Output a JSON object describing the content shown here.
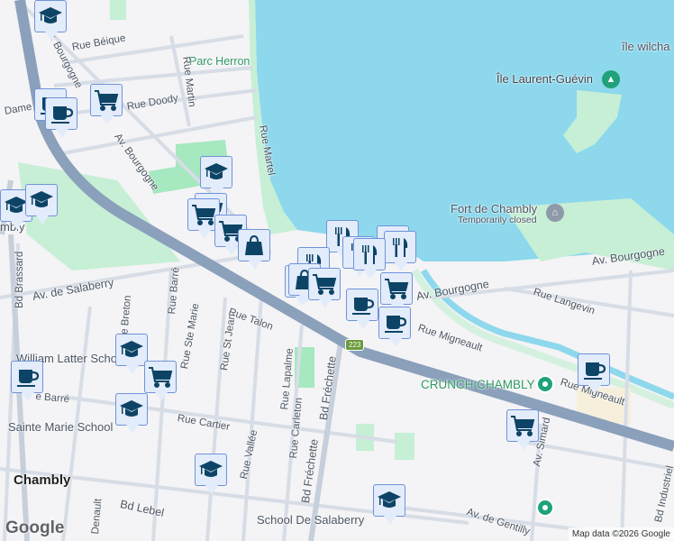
{
  "map": {
    "labels": {
      "parc_herron": "Parc Herron",
      "ile_wilchard": "île wilcha",
      "ile_laurent": "Île Laurent-Guévin",
      "fort_chambly": "Fort de Chambly",
      "fort_status": "Temporarily closed",
      "rue_beique": "Rue Béique",
      "rue_martin": "Rue Martin",
      "rue_martel": "Rue Martel",
      "rue_doody": "Rue Doody",
      "rue_dame": "Dame",
      "av_bourgogne_1": "Av. Bourgogne",
      "av_bourgogne_2": "Av. Bourgogne",
      "av_bourgogne_3": "Av. Bourgogne",
      "av_bourgogne_4": "Av. Bourgogne",
      "bd_brassard": "Bd Brassard",
      "av_salaberry": "Av. de Salaberry",
      "rue_barre": "Rue Barré",
      "rue_breton": "Rue Breton",
      "rue_ste_marie": "Rue Ste Marie",
      "rue_talon": "Rue Talon",
      "rue_st_jean": "Rue St Jean",
      "rue_lapalme": "Rue Lapalme",
      "rue_carleton": "Rue Carleton",
      "bd_frechette": "Bd Fréchette",
      "rue_cartier": "Rue Cartier",
      "rue_vallee": "Rue Vallée",
      "rue_barre_2": "e Barré",
      "rue_langevin": "Rue Langevin",
      "rue_migneault": "Rue Migneault",
      "rue_migneault_2": "Rue Migneault",
      "av_simard": "Av. Simard",
      "av_gentilly": "Av. de Gentilly",
      "bd_industriel": "Bd Industriel",
      "bd_lebel": "Bd Lebel",
      "chambly": "Chambly",
      "chambly_partial": "mbly",
      "william_latter": "William Latter School",
      "sainte_marie": "Sainte Marie School",
      "school_salaberry": "School De Salaberry",
      "crunch": "CRUNCH CHAMBLY",
      "denault": "Denault",
      "route_223": "223"
    },
    "markers": [
      "school",
      "cafe",
      "cafe",
      "grocery",
      "school",
      "school",
      "school",
      "grocery",
      "grocery",
      "grocery",
      "shopping",
      "restaurant",
      "restaurant",
      "restaurant",
      "restaurant",
      "restaurant",
      "restaurant",
      "shopping",
      "shopping",
      "grocery",
      "grocery",
      "cafe",
      "cafe",
      "school",
      "grocery",
      "school",
      "cafe",
      "school",
      "school",
      "cafe",
      "grocery"
    ],
    "google_logo": "Google",
    "attribution": "Map data ©2026 Google",
    "colors": {
      "water": "#8dd8ec",
      "park": "#c6efd6",
      "highway": "#8aa0bb",
      "marker_bg": "#e3ecfb",
      "marker_icon": "#0d4466",
      "poi": "#1fa27a"
    }
  }
}
